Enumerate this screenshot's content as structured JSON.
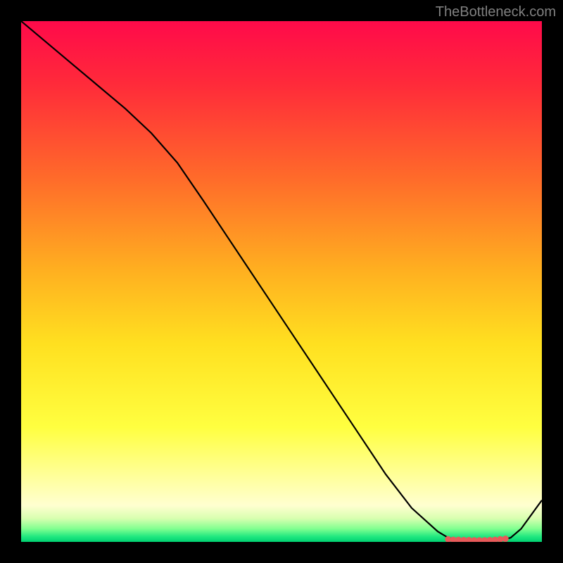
{
  "watermark": "TheBottleneck.com",
  "chart_data": {
    "type": "line",
    "title": "",
    "xlabel": "",
    "ylabel": "",
    "x_range": [
      0,
      100
    ],
    "y_range": [
      0,
      100
    ],
    "series": [
      {
        "name": "curve",
        "x": [
          0,
          5,
          10,
          15,
          20,
          25,
          30,
          35,
          40,
          45,
          50,
          55,
          60,
          65,
          70,
          75,
          80,
          82,
          84,
          86,
          88,
          90,
          92,
          94,
          96,
          100
        ],
        "y": [
          100,
          95.8,
          91.6,
          87.4,
          83.2,
          78.5,
          72.8,
          65.5,
          58.0,
          50.5,
          43.0,
          35.5,
          28.0,
          20.5,
          13.0,
          6.5,
          2.0,
          0.8,
          0.4,
          0.3,
          0.3,
          0.3,
          0.3,
          0.8,
          2.5,
          8.0
        ]
      }
    ],
    "markers": {
      "name": "bottom-dots",
      "x": [
        82,
        83,
        84,
        85,
        86,
        87,
        88,
        89,
        90,
        91,
        92,
        93
      ],
      "y": [
        0.5,
        0.4,
        0.4,
        0.35,
        0.35,
        0.3,
        0.3,
        0.3,
        0.35,
        0.4,
        0.5,
        0.6
      ],
      "color": "#e85a5a"
    },
    "gradient_stops": [
      {
        "offset": 0,
        "color": "#ff0a4a"
      },
      {
        "offset": 0.12,
        "color": "#ff2a3a"
      },
      {
        "offset": 0.3,
        "color": "#ff6a2a"
      },
      {
        "offset": 0.48,
        "color": "#ffb020"
      },
      {
        "offset": 0.62,
        "color": "#ffe020"
      },
      {
        "offset": 0.78,
        "color": "#ffff40"
      },
      {
        "offset": 0.88,
        "color": "#ffffa0"
      },
      {
        "offset": 0.93,
        "color": "#ffffd0"
      },
      {
        "offset": 0.955,
        "color": "#d8ffb0"
      },
      {
        "offset": 0.975,
        "color": "#80ff90"
      },
      {
        "offset": 0.99,
        "color": "#20e880"
      },
      {
        "offset": 1.0,
        "color": "#00d070"
      }
    ]
  }
}
